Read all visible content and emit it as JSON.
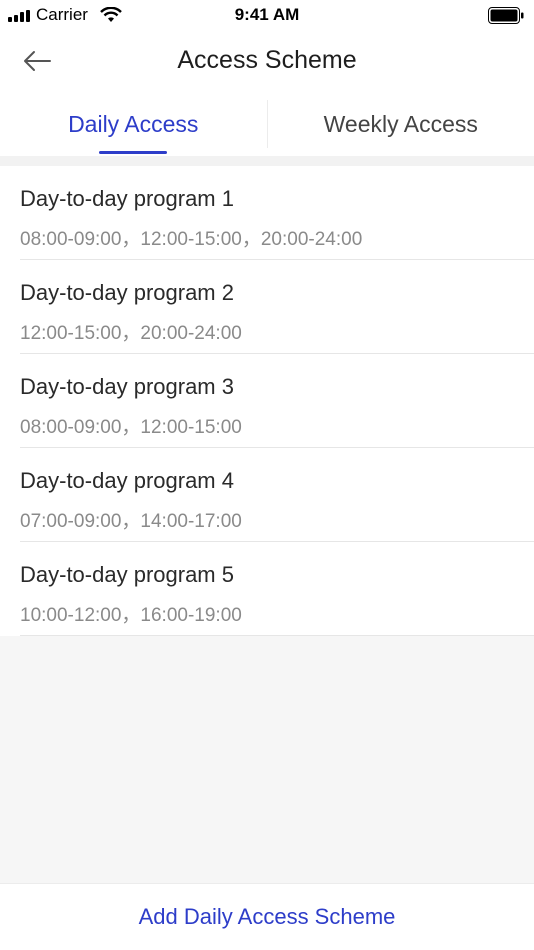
{
  "status_bar": {
    "carrier": "Carrier",
    "time": "9:41 AM"
  },
  "header": {
    "title": "Access Scheme",
    "back_icon": "arrow-left-icon"
  },
  "tabs": [
    {
      "label": "Daily Access",
      "active": true
    },
    {
      "label": "Weekly Access",
      "active": false
    }
  ],
  "programs": [
    {
      "title": "Day-to-day program 1",
      "times": "08:00-09:00，12:00-15:00，20:00-24:00"
    },
    {
      "title": "Day-to-day program 2",
      "times": "12:00-15:00，20:00-24:00"
    },
    {
      "title": "Day-to-day program 3",
      "times": "08:00-09:00，12:00-15:00"
    },
    {
      "title": "Day-to-day program 4",
      "times": "07:00-09:00，14:00-17:00"
    },
    {
      "title": "Day-to-day program 5",
      "times": "10:00-12:00，16:00-19:00"
    }
  ],
  "footer": {
    "add_label": "Add Daily Access Scheme"
  },
  "colors": {
    "accent": "#2d3dc9",
    "background": "#f6f6f6"
  }
}
